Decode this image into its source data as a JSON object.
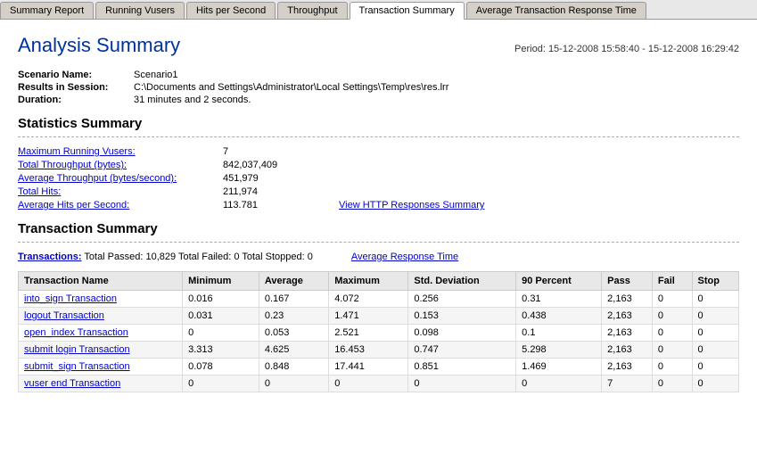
{
  "tabs": [
    {
      "label": "Summary Report",
      "active": false
    },
    {
      "label": "Running Vusers",
      "active": false
    },
    {
      "label": "Hits per Second",
      "active": false
    },
    {
      "label": "Throughput",
      "active": false
    },
    {
      "label": "Transaction Summary",
      "active": true
    },
    {
      "label": "Average Transaction Response Time",
      "active": false
    }
  ],
  "header": {
    "title": "Analysis Summary",
    "period_label": "Period:",
    "period_value": "15-12-2008 15:58:40 - 15-12-2008 16:29:42"
  },
  "info": {
    "scenario_label": "Scenario Name:",
    "scenario_value": "Scenario1",
    "results_label": "Results in Session:",
    "results_value": "C:\\Documents and Settings\\Administrator\\Local Settings\\Temp\\res\\res.lrr",
    "duration_label": "Duration:",
    "duration_value": "31 minutes and 2 seconds."
  },
  "statistics": {
    "title": "Statistics Summary",
    "rows": [
      {
        "label": "Maximum Running Vusers:",
        "value": "7",
        "link": null
      },
      {
        "label": "Total Throughput (bytes):",
        "value": "842,037,409",
        "link": null
      },
      {
        "label": "Average Throughput (bytes/second):",
        "value": "451,979",
        "link": null
      },
      {
        "label": "Total Hits:",
        "value": "211,974",
        "link": null
      },
      {
        "label": "Average Hits per Second:",
        "value": "113.781",
        "link": "View HTTP Responses Summary"
      }
    ]
  },
  "transaction_summary": {
    "title": "Transaction Summary",
    "transactions_label": "Transactions:",
    "transactions_info": "Total Passed: 10,829 Total Failed: 0 Total Stopped: 0",
    "avg_response_link": "Average Response Time",
    "table": {
      "headers": [
        "Transaction Name",
        "Minimum",
        "Average",
        "Maximum",
        "Std. Deviation",
        "90 Percent",
        "Pass",
        "Fail",
        "Stop"
      ],
      "rows": [
        {
          "name": "into_sign Transaction",
          "min": "0.016",
          "avg": "0.167",
          "max": "4.072",
          "std": "0.256",
          "p90": "0.31",
          "pass": "2,163",
          "fail": "0",
          "stop": "0"
        },
        {
          "name": "logout Transaction",
          "min": "0.031",
          "avg": "0.23",
          "max": "1.471",
          "std": "0.153",
          "p90": "0.438",
          "pass": "2,163",
          "fail": "0",
          "stop": "0"
        },
        {
          "name": "open_index Transaction",
          "min": "0",
          "avg": "0.053",
          "max": "2.521",
          "std": "0.098",
          "p90": "0.1",
          "pass": "2,163",
          "fail": "0",
          "stop": "0"
        },
        {
          "name": "submit login Transaction",
          "min": "3.313",
          "avg": "4.625",
          "max": "16.453",
          "std": "0.747",
          "p90": "5.298",
          "pass": "2,163",
          "fail": "0",
          "stop": "0"
        },
        {
          "name": "submit_sign Transaction",
          "min": "0.078",
          "avg": "0.848",
          "max": "17.441",
          "std": "0.851",
          "p90": "1.469",
          "pass": "2,163",
          "fail": "0",
          "stop": "0"
        },
        {
          "name": "vuser end Transaction",
          "min": "0",
          "avg": "0",
          "max": "0",
          "std": "0",
          "p90": "0",
          "pass": "7",
          "fail": "0",
          "stop": "0"
        }
      ]
    }
  }
}
